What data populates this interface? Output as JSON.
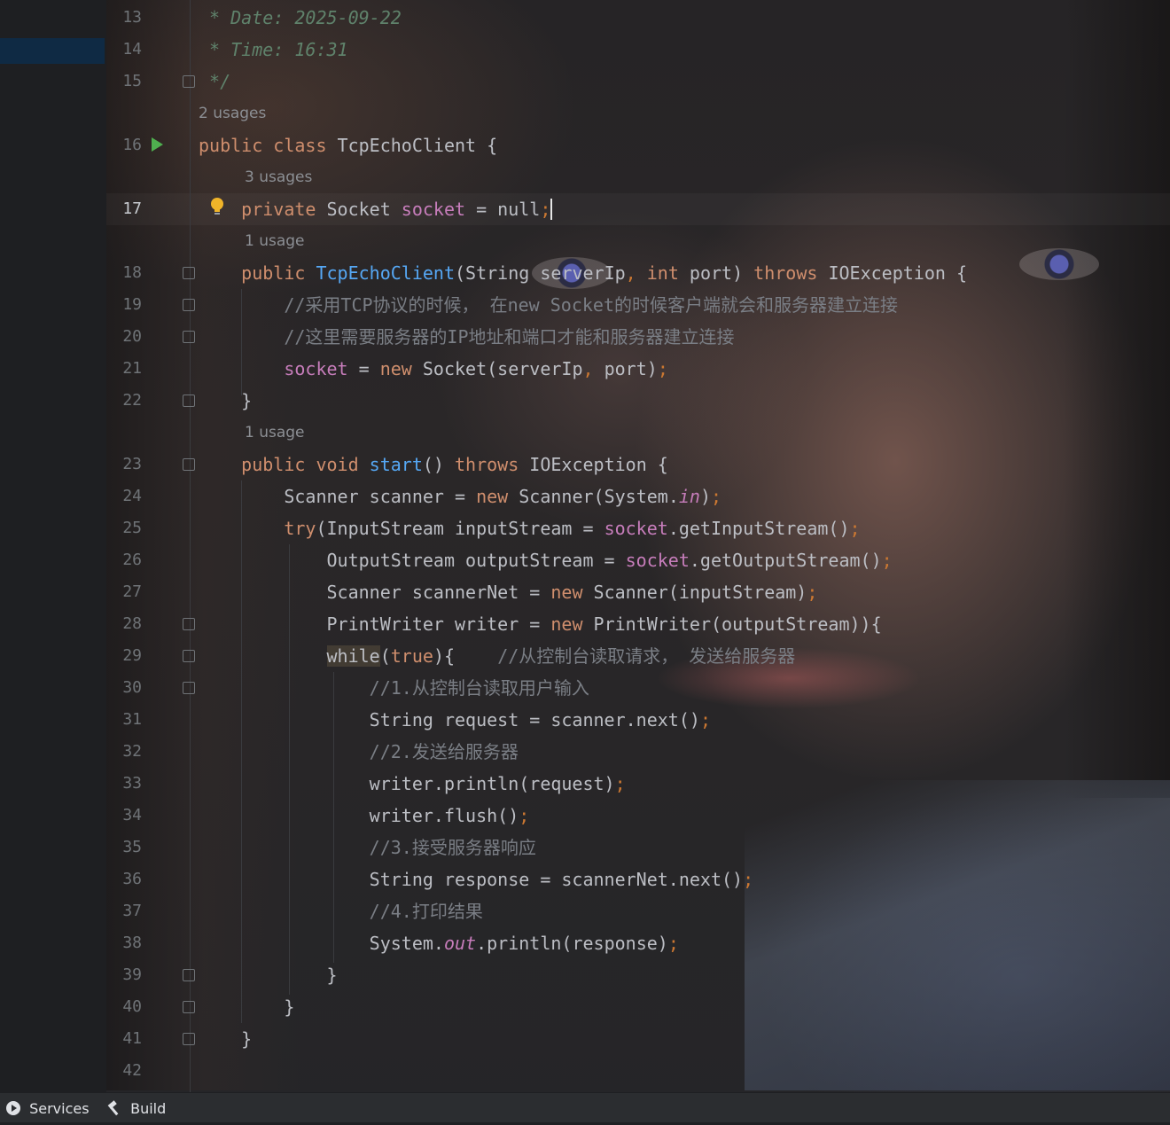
{
  "editor": {
    "current_line": 17,
    "lines": [
      {
        "n": 13,
        "segments": [
          [
            "doc",
            " * Date: 2025-09-22"
          ]
        ]
      },
      {
        "n": 14,
        "segments": [
          [
            "doc",
            " * Time: 16:31"
          ]
        ]
      },
      {
        "n": 15,
        "segments": [
          [
            "doc",
            " */"
          ]
        ]
      },
      {
        "n": 16,
        "segments": [
          [
            "kw",
            "public class "
          ],
          [
            "cls",
            "TcpEchoClient {"
          ]
        ]
      },
      {
        "n": 17,
        "segments": [
          [
            "kw",
            "    private "
          ],
          [
            "cls",
            "Socket "
          ],
          [
            "fld",
            "socket"
          ],
          [
            "cls",
            " = "
          ],
          [
            "nul",
            "null"
          ],
          [
            "semi",
            ";"
          ]
        ]
      },
      {
        "n": 18,
        "segments": [
          [
            "kw",
            "    public "
          ],
          [
            "fn",
            "TcpEchoClient"
          ],
          [
            "cls",
            "(String serverIp"
          ],
          [
            "semi",
            ", "
          ],
          [
            "kw",
            "int "
          ],
          [
            "cls",
            "port) "
          ],
          [
            "kw",
            "throws "
          ],
          [
            "cls",
            "IOException {"
          ]
        ]
      },
      {
        "n": 19,
        "segments": [
          [
            "cm",
            "        //采用TCP协议的时候， 在new Socket的时候客户端就会和服务器建立连接"
          ]
        ]
      },
      {
        "n": 20,
        "segments": [
          [
            "cm",
            "        //这里需要服务器的IP地址和端口才能和服务器建立连接"
          ]
        ]
      },
      {
        "n": 21,
        "segments": [
          [
            "fld",
            "        socket"
          ],
          [
            "cls",
            " = "
          ],
          [
            "kw",
            "new "
          ],
          [
            "cls",
            "Socket(serverIp"
          ],
          [
            "semi",
            ", "
          ],
          [
            "cls",
            "port)"
          ],
          [
            "semi",
            ";"
          ]
        ]
      },
      {
        "n": 22,
        "segments": [
          [
            "cls",
            "    }"
          ]
        ]
      },
      {
        "n": 23,
        "segments": [
          [
            "kw",
            "    public void "
          ],
          [
            "fn",
            "start"
          ],
          [
            "cls",
            "() "
          ],
          [
            "kw",
            "throws "
          ],
          [
            "cls",
            "IOException {"
          ]
        ]
      },
      {
        "n": 24,
        "segments": [
          [
            "cls",
            "        Scanner scanner = "
          ],
          [
            "kw",
            "new "
          ],
          [
            "cls",
            "Scanner(System."
          ],
          [
            "st",
            "in"
          ],
          [
            "cls",
            ")"
          ],
          [
            "semi",
            ";"
          ]
        ]
      },
      {
        "n": 25,
        "segments": [
          [
            "kw",
            "        try"
          ],
          [
            "cls",
            "(InputStream inputStream = "
          ],
          [
            "fld",
            "socket"
          ],
          [
            "cls",
            ".getInputStream()"
          ],
          [
            "semi",
            ";"
          ]
        ]
      },
      {
        "n": 26,
        "segments": [
          [
            "cls",
            "            OutputStream outputStream = "
          ],
          [
            "fld",
            "socket"
          ],
          [
            "cls",
            ".getOutputStream()"
          ],
          [
            "semi",
            ";"
          ]
        ]
      },
      {
        "n": 27,
        "segments": [
          [
            "cls",
            "            Scanner scannerNet = "
          ],
          [
            "kw",
            "new "
          ],
          [
            "cls",
            "Scanner(inputStream)"
          ],
          [
            "semi",
            ";"
          ]
        ]
      },
      {
        "n": 28,
        "segments": [
          [
            "cls",
            "            PrintWriter writer = "
          ],
          [
            "kw",
            "new "
          ],
          [
            "cls",
            "PrintWriter(outputStream)){"
          ]
        ]
      },
      {
        "n": 29,
        "segments": [
          [
            "cls",
            "            "
          ],
          [
            "wh",
            "while"
          ],
          [
            "cls",
            "("
          ],
          [
            "kw",
            "true"
          ],
          [
            "cls",
            "){    "
          ],
          [
            "cm",
            "//从控制台读取请求， 发送给服务器"
          ]
        ]
      },
      {
        "n": 30,
        "segments": [
          [
            "cm",
            "                //1.从控制台读取用户输入"
          ]
        ]
      },
      {
        "n": 31,
        "segments": [
          [
            "cls",
            "                String request = scanner.next()"
          ],
          [
            "semi",
            ";"
          ]
        ]
      },
      {
        "n": 32,
        "segments": [
          [
            "cm",
            "                //2.发送给服务器"
          ]
        ]
      },
      {
        "n": 33,
        "segments": [
          [
            "cls",
            "                writer.println(request)"
          ],
          [
            "semi",
            ";"
          ]
        ]
      },
      {
        "n": 34,
        "segments": [
          [
            "cls",
            "                writer.flush()"
          ],
          [
            "semi",
            ";"
          ]
        ]
      },
      {
        "n": 35,
        "segments": [
          [
            "cm",
            "                //3.接受服务器响应"
          ]
        ]
      },
      {
        "n": 36,
        "segments": [
          [
            "cls",
            "                String response = scannerNet.next()"
          ],
          [
            "semi",
            ";"
          ]
        ]
      },
      {
        "n": 37,
        "segments": [
          [
            "cm",
            "                //4.打印结果"
          ]
        ]
      },
      {
        "n": 38,
        "segments": [
          [
            "cls",
            "                System."
          ],
          [
            "st",
            "out"
          ],
          [
            "cls",
            ".println(response)"
          ],
          [
            "semi",
            ";"
          ]
        ]
      },
      {
        "n": 39,
        "segments": [
          [
            "cls",
            "            }"
          ]
        ]
      },
      {
        "n": 40,
        "segments": [
          [
            "cls",
            "        }"
          ]
        ]
      },
      {
        "n": 41,
        "segments": [
          [
            "cls",
            "    }"
          ]
        ]
      },
      {
        "n": 42,
        "segments": []
      }
    ],
    "hints": {
      "class_usages": "2 usages",
      "field_usages": "3 usages",
      "ctor_usages": "1 usage",
      "start_usages": "1 usage"
    }
  },
  "statusbar": {
    "services_label": "Services",
    "build_label": "Build"
  },
  "colors": {
    "keyword": "#cf8e6d",
    "function": "#56a8f5",
    "field": "#c77dbb",
    "doc_comment": "#5f826b",
    "comment": "#7a7e85",
    "text": "#bcbec4"
  },
  "icons": [
    "run-icon",
    "lightbulb-icon",
    "fold-icon",
    "services-icon",
    "build-hammer-icon"
  ]
}
